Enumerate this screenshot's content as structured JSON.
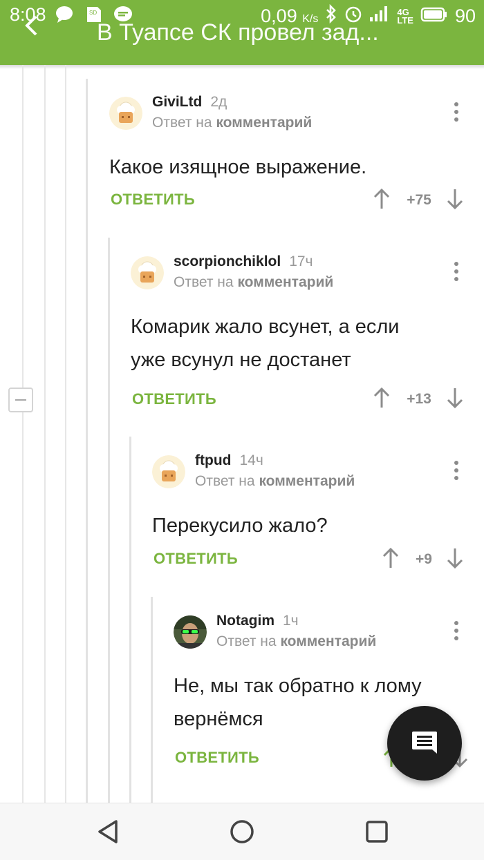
{
  "status_bar": {
    "time": "8:08",
    "network_speed": "0,09",
    "network_speed_unit": "K/s",
    "battery": "90",
    "network_type": "4G"
  },
  "header": {
    "title": "В Туапсе СК провел зад..."
  },
  "comments": [
    {
      "author": "GiviLtd",
      "time": "2д",
      "reply_prefix": "Ответ на",
      "reply_target": "комментарий",
      "text": "Какое изящное выражение.",
      "reply_label": "ОТВЕТИТЬ",
      "score": "+75"
    },
    {
      "author": "scorpionchiklol",
      "time": "17ч",
      "reply_prefix": "Ответ на",
      "reply_target": "комментарий",
      "text_line1": "Комарик жало всунет, а если",
      "text_line2": "уже всунул не достанет",
      "reply_label": "ОТВЕТИТЬ",
      "score": "+13"
    },
    {
      "author": "ftpud",
      "time": "14ч",
      "reply_prefix": "Ответ на",
      "reply_target": "комментарий",
      "text": "Перекусило жало?",
      "reply_label": "ОТВЕТИТЬ",
      "score": "+9"
    },
    {
      "author": "Notagim",
      "time": "1ч",
      "reply_prefix": "Ответ на",
      "reply_target": "комментарий",
      "text_line1": "Не, мы так обратно к лому",
      "text_line2": "вернёмся",
      "reply_label": "ОТВЕТИТЬ"
    }
  ],
  "colors": {
    "brand_green": "#7bb53f",
    "fab_background": "#1e1e1e"
  },
  "icons": {
    "fab": "comment-icon",
    "nav_back": "triangle-back-icon",
    "nav_home": "circle-home-icon",
    "nav_recents": "square-recents-icon"
  }
}
